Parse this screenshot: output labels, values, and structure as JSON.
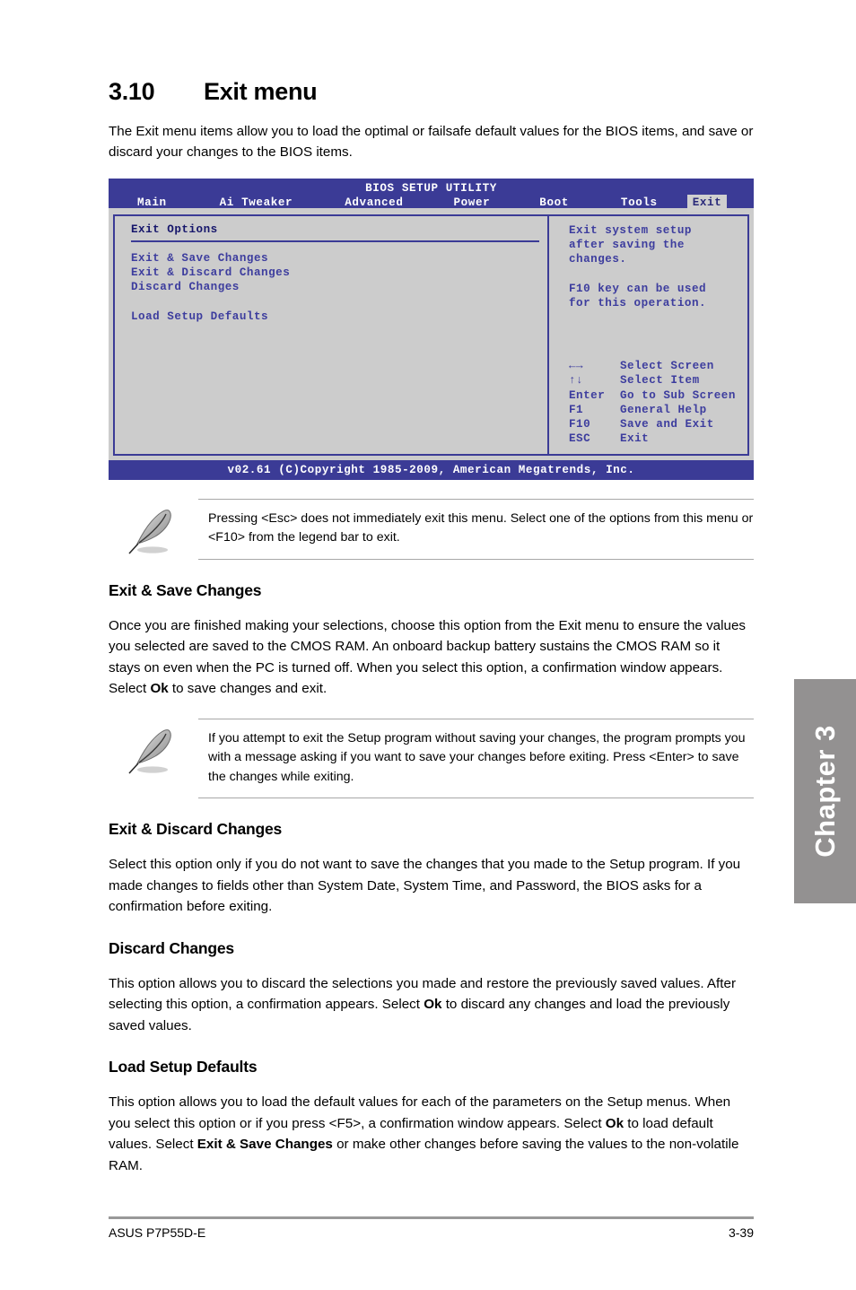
{
  "page": {
    "section_number": "3.10",
    "section_title": "Exit menu",
    "intro": "The Exit menu items allow you to load the optimal or failsafe default values for the BIOS items, and save or discard your changes to the BIOS items.",
    "chapter_tab": "Chapter 3",
    "footer_left": "ASUS P7P55D-E",
    "footer_right": "3-39"
  },
  "bios": {
    "title": "BIOS SETUP UTILITY",
    "tabs": [
      {
        "label": "Main",
        "active": false
      },
      {
        "label": "Ai Tweaker",
        "active": false
      },
      {
        "label": "Advanced",
        "active": false
      },
      {
        "label": "Power",
        "active": false
      },
      {
        "label": "Boot",
        "active": false
      },
      {
        "label": "Tools",
        "active": false
      },
      {
        "label": "Exit",
        "active": true
      }
    ],
    "left_panel_heading": "Exit Options",
    "menu_items": [
      "Exit & Save Changes",
      "Exit & Discard Changes",
      "Discard Changes"
    ],
    "menu_items_group2": [
      "Load Setup Defaults"
    ],
    "help_paragraph_1": "Exit system setup\nafter saving the\nchanges.",
    "help_paragraph_2": "F10 key can be used\nfor this operation.",
    "legend": [
      {
        "key": "←→",
        "action": "Select Screen"
      },
      {
        "key": "↑↓",
        "action": "Select Item"
      },
      {
        "key": "Enter",
        "action": "Go to Sub Screen"
      },
      {
        "key": "F1",
        "action": "General Help"
      },
      {
        "key": "F10",
        "action": "Save and Exit"
      },
      {
        "key": "ESC",
        "action": "Exit"
      }
    ],
    "footer": "v02.61 (C)Copyright 1985-2009, American Megatrends, Inc.",
    "colors": {
      "header_bg": "#3b3b96",
      "body_bg": "#cccccc",
      "text_blue": "#3d3d9e",
      "active_tab_bg": "#cfcfcf"
    }
  },
  "notes": {
    "note1": "Pressing <Esc> does not immediately exit this menu. Select one of the options from this menu or <F10> from the legend bar to exit.",
    "note2": "If you attempt to exit the Setup program without saving your changes, the program prompts you with a message asking if you want to save your changes before exiting. Press <Enter> to save the changes while exiting."
  },
  "sections": {
    "exit_save": {
      "heading": "Exit & Save Changes",
      "text_a": "Once you are finished making your selections, choose this option from the Exit menu to ensure the values you selected are saved to the CMOS RAM. An onboard backup battery sustains the CMOS RAM so it stays on even when the PC is turned off. When you select this option, a confirmation window appears. Select ",
      "bold_b": "Ok",
      "text_c": " to save changes and exit."
    },
    "exit_discard": {
      "heading": "Exit & Discard Changes",
      "text": "Select this option only if you do not want to save the changes that you made to the Setup program. If you made changes to fields other than System Date, System Time, and Password, the BIOS asks for a confirmation before exiting."
    },
    "discard": {
      "heading": "Discard Changes",
      "text_a": "This option allows you to discard the selections you made and restore the previously saved values. After selecting this option, a confirmation appears. Select ",
      "bold_b": "Ok",
      "text_c": " to discard any changes and load the previously saved values."
    },
    "load_defaults": {
      "heading": "Load Setup Defaults",
      "text_a": "This option allows you to load the default values for each of the parameters on the Setup menus. When you select this option or if you press <F5>, a confirmation window appears. Select ",
      "bold_b": "Ok",
      "text_c": " to load default values. Select ",
      "bold_d": "Exit & Save Changes",
      "text_e": " or make other changes before saving the values to the non-volatile RAM."
    }
  }
}
